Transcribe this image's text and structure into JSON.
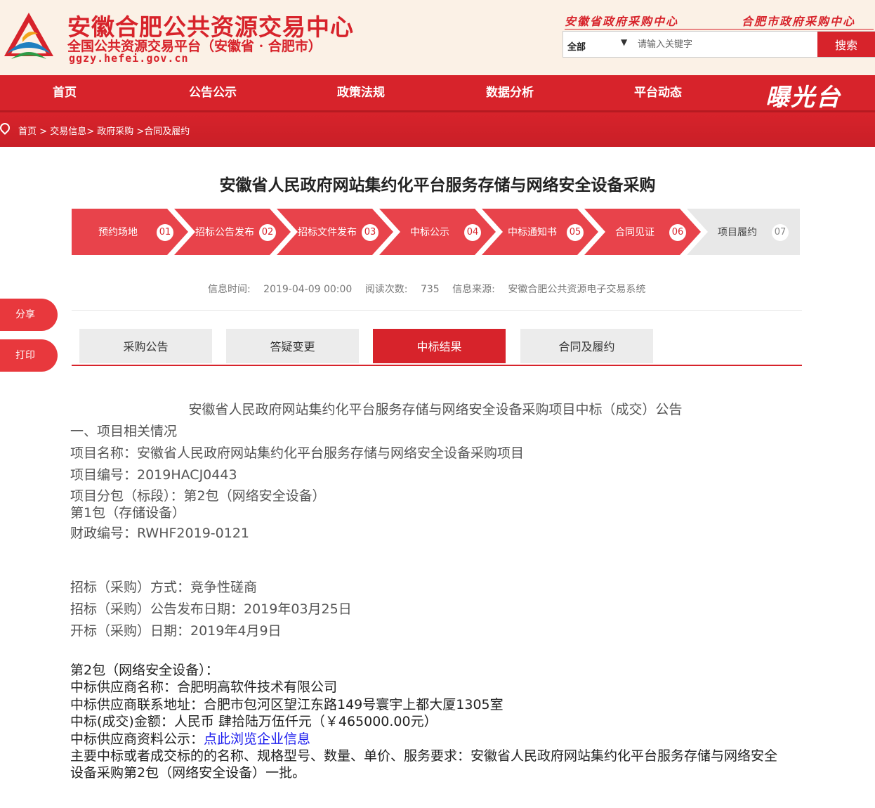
{
  "header": {
    "title": "安徽合肥公共资源交易中心",
    "subtitle": "全国公共资源交易平台（安徽省 · 合肥市）",
    "domain": "ggzy.hefei.gov.cn",
    "link_province": "安徽省政府采购中心",
    "link_city": "合肥市政府采购中心",
    "search_select": "全部",
    "search_placeholder": "请输入关键字",
    "search_button": "搜索"
  },
  "nav": {
    "items": [
      "首页",
      "公告公示",
      "政策法规",
      "数据分析",
      "平台动态"
    ],
    "brand": "曝光台"
  },
  "breadcrumb": {
    "home": "首页",
    "sep1": " > ",
    "trade": "交易信息",
    "sep2": "> ",
    "gov": "政府采购",
    "sep3": " >",
    "current": "合同及履约"
  },
  "page_title": "安徽省人民政府网站集约化平台服务存储与网络安全设备采购",
  "steps": [
    {
      "label": "预约场地",
      "num": "01"
    },
    {
      "label": "招标公告发布",
      "num": "02"
    },
    {
      "label": "招标文件发布",
      "num": "03"
    },
    {
      "label": "中标公示",
      "num": "04"
    },
    {
      "label": "中标通知书",
      "num": "05"
    },
    {
      "label": "合同见证",
      "num": "06"
    },
    {
      "label": "项目履约",
      "num": "07"
    }
  ],
  "info": {
    "time_label": "信息时间:",
    "time_value": "2019-04-09 00:00",
    "views_label": "阅读次数:",
    "views_value": "735",
    "source_label": "信息来源:",
    "source_value": "安徽合肥公共资源电子交易系统"
  },
  "side": {
    "share": "分享",
    "print": "打印"
  },
  "tabs": [
    "采购公告",
    "答疑变更",
    "中标结果",
    "合同及履约"
  ],
  "content": {
    "heading": "安徽省人民政府网站集约化平台服务存储与网络安全设备采购项目中标（成交）公告",
    "section1": "一、项目相关情况",
    "project_name": "项目名称：安徽省人民政府网站集约化平台服务存储与网络安全设备采购项目",
    "project_no": "项目编号：2019HACJ0443",
    "lot": "项目分包（标段）：第2包（网络安全设备）",
    "lot2": "第1包（存储设备）",
    "finance_no": "财政编号：RWHF2019-0121",
    "method": "招标（采购）方式：竞争性磋商",
    "publish_date": "招标（采购）公告发布日期：2019年03月25日",
    "open_date": "开标（采购）日期：2019年4月9日",
    "pkg2": "第2包（网络安全设备）：",
    "supplier": "中标供应商名称：合肥明高软件技术有限公司",
    "address": "中标供应商联系地址：合肥市包河区望江东路149号寰宇上都大厦1305室",
    "amount": "中标(成交)金额：人民币 肆拾陆万伍仟元（￥465000.00元）",
    "info_label": "中标供应商资料公示：",
    "info_link": "点此浏览企业信息",
    "requirement1": "主要中标或者成交标的的名称、规格型号、数量、单价、服务要求：安徽省人民政府网站集约化平台服务存储与网络安全",
    "requirement2": "设备采购第2包（网络安全设备）一批。"
  },
  "colors": {
    "brand_red": "#d7232b",
    "header_bg": "#fbf1e6",
    "inactive_step": "#e8e8e8"
  }
}
